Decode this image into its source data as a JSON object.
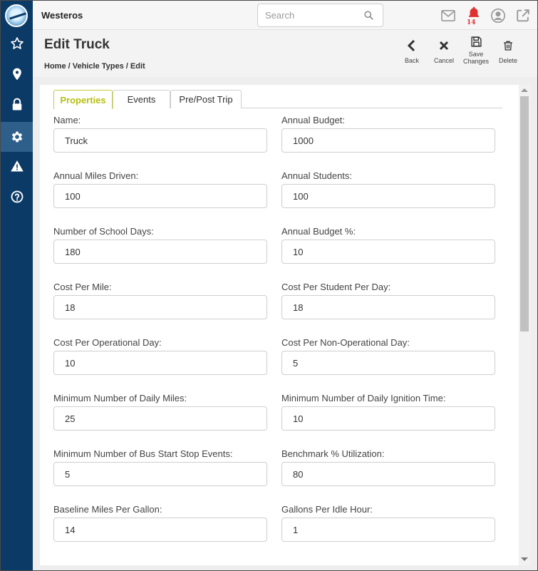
{
  "app": {
    "name": "Westeros"
  },
  "search": {
    "placeholder": "Search"
  },
  "notifications": {
    "count": "14"
  },
  "header": {
    "title": "Edit Truck",
    "breadcrumb": [
      "Home",
      "/",
      "Vehicle Types",
      "/",
      "Edit"
    ]
  },
  "actions": {
    "back": "Back",
    "cancel": "Cancel",
    "save_line1": "Save",
    "save_line2": "Changes",
    "delete": "Delete"
  },
  "tabs": [
    "Properties",
    "Events",
    "Pre/Post Trip"
  ],
  "form": {
    "fields": [
      {
        "label": "Name:",
        "value": "Truck"
      },
      {
        "label": "Annual Budget:",
        "value": "1000"
      },
      {
        "label": "Annual Miles Driven:",
        "value": "100"
      },
      {
        "label": "Annual Students:",
        "value": "100"
      },
      {
        "label": "Number of School Days:",
        "value": "180"
      },
      {
        "label": "Annual Budget %:",
        "value": "10"
      },
      {
        "label": "Cost Per Mile:",
        "value": "18"
      },
      {
        "label": "Cost Per Student Per Day:",
        "value": "18"
      },
      {
        "label": "Cost Per Operational Day:",
        "value": "10"
      },
      {
        "label": "Cost Per Non-Operational Day:",
        "value": "5"
      },
      {
        "label": "Minimum Number of Daily Miles:",
        "value": "25"
      },
      {
        "label": "Minimum Number of Daily Ignition Time:",
        "value": "10"
      },
      {
        "label": "Minimum Number of Bus Start Stop Events:",
        "value": "5"
      },
      {
        "label": "Benchmark % Utilization:",
        "value": "80"
      },
      {
        "label": "Baseline Miles Per Gallon:",
        "value": "14"
      },
      {
        "label": "Gallons Per Idle Hour:",
        "value": "1"
      }
    ]
  },
  "colors": {
    "sidebar": "#0c3a66",
    "sidebar_active": "#2e5f8b",
    "tab_active": "#b6bf10",
    "bell": "#e03131"
  },
  "icons": {
    "sidebar": [
      "star-icon",
      "location-pin-icon",
      "lock-icon",
      "gear-icon",
      "warning-icon",
      "help-icon"
    ],
    "topbar": [
      "search-icon",
      "mail-icon",
      "bell-icon",
      "user-icon",
      "external-link-icon"
    ],
    "actions": [
      "chevron-left-icon",
      "close-icon",
      "save-icon",
      "trash-icon"
    ]
  }
}
